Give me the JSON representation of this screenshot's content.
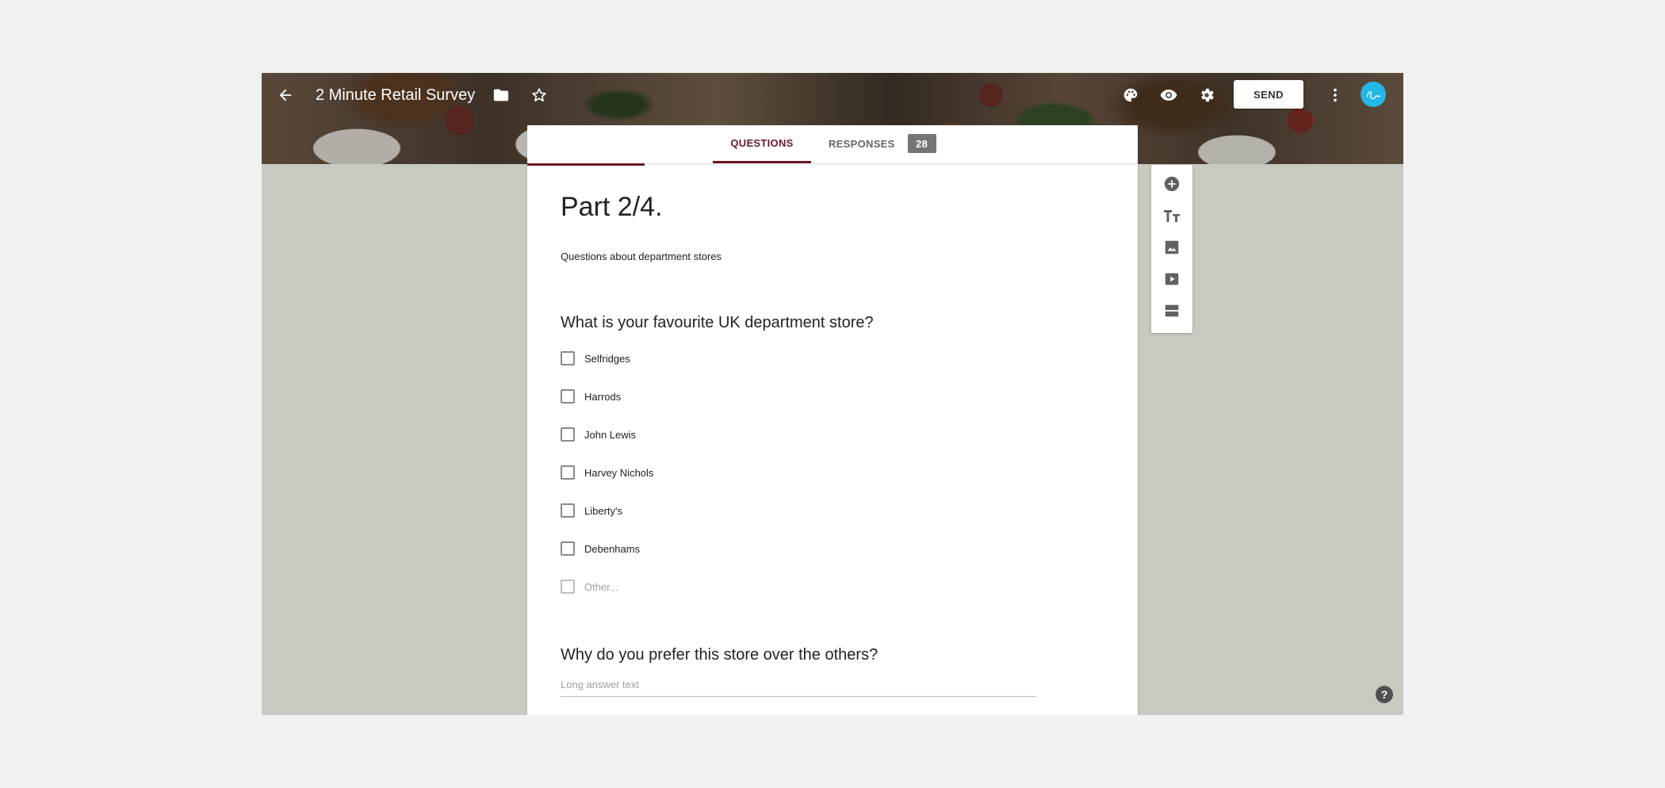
{
  "header": {
    "title": "2 Minute Retail Survey",
    "send_label": "SEND",
    "icons": [
      "back-arrow-icon",
      "folder-icon",
      "star-icon",
      "palette-icon",
      "eye-icon",
      "gear-icon",
      "more-vert-icon"
    ]
  },
  "tabs": {
    "questions": "QUESTIONS",
    "responses": "RESPONSES",
    "responses_count": "28"
  },
  "section": {
    "title": "Part 2/4.",
    "description": "Questions about department stores"
  },
  "questions": [
    {
      "title": "What is your favourite UK department store?",
      "type": "checkboxes",
      "options": [
        "Selfridges",
        "Harrods",
        "John Lewis",
        "Harvey Nichols",
        "Liberty's",
        "Debenhams"
      ],
      "other_label": "Other..."
    },
    {
      "title": "Why do you prefer this store over the others?",
      "type": "paragraph",
      "placeholder": "Long answer text"
    }
  ],
  "toolbox": {
    "tools": [
      "add-question-icon",
      "add-title-icon",
      "add-image-icon",
      "add-video-icon",
      "add-section-icon"
    ]
  },
  "help_label": "?",
  "colors": {
    "accent": "#6b1a28",
    "background": "#c7cac1",
    "avatar": "#23b7e5"
  }
}
